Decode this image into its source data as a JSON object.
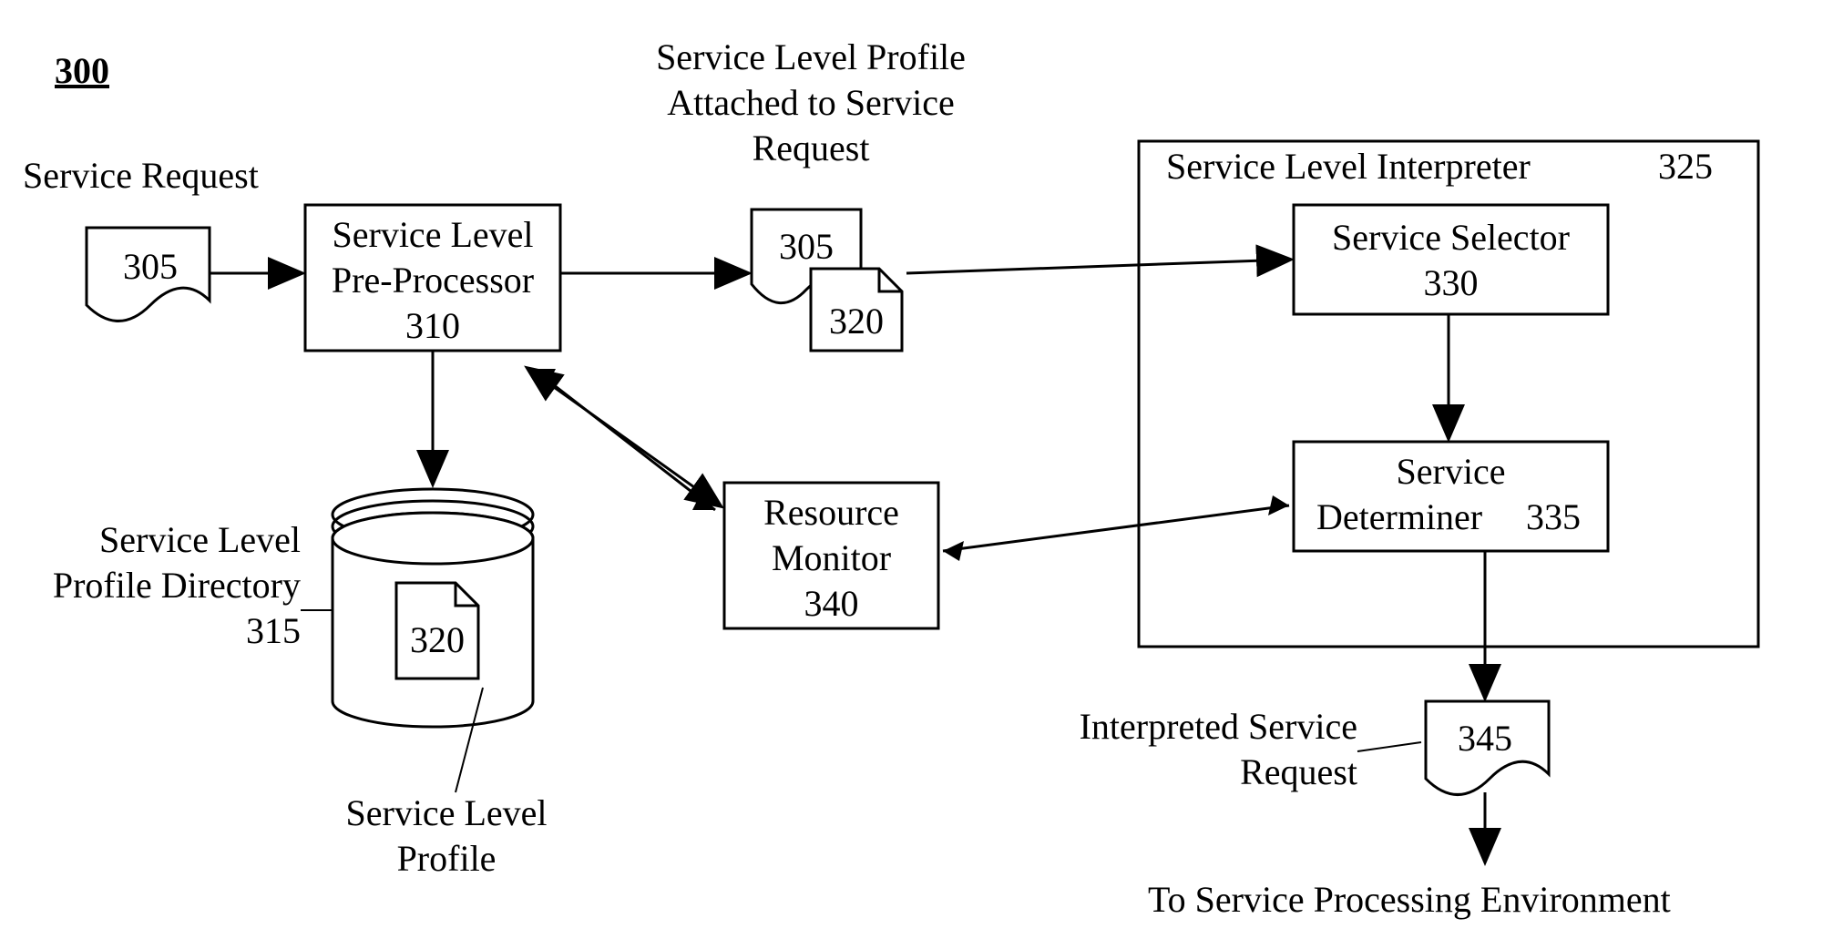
{
  "figureNumber": "300",
  "labels": {
    "serviceRequest": "Service Request",
    "profileAttached1": "Service Level Profile",
    "profileAttached2": "Attached to Service",
    "profileAttached3": "Request",
    "sliTitle": "Service Level Interpreter",
    "sliNum": "325",
    "slpd": "Service Level",
    "slpd2": "Profile Directory",
    "slpd3": "315",
    "slp1": "Service Level",
    "slp2": "Profile",
    "interp1": "Interpreted Service",
    "interp2": "Request",
    "toEnv": "To Service Processing Environment"
  },
  "nodes": {
    "request305": "305",
    "preProcessor": {
      "l1": "Service Level",
      "l2": "Pre-Processor",
      "l3": "310"
    },
    "attached305": "305",
    "attached320": "320",
    "db320": "320",
    "resourceMonitor": {
      "l1": "Resource",
      "l2": "Monitor",
      "l3": "340"
    },
    "serviceSelector": {
      "l1": "Service Selector",
      "l2": "330"
    },
    "serviceDeterminer": {
      "l1": "Service",
      "l2": "Determiner",
      "l3": "335"
    },
    "out345": "345"
  }
}
